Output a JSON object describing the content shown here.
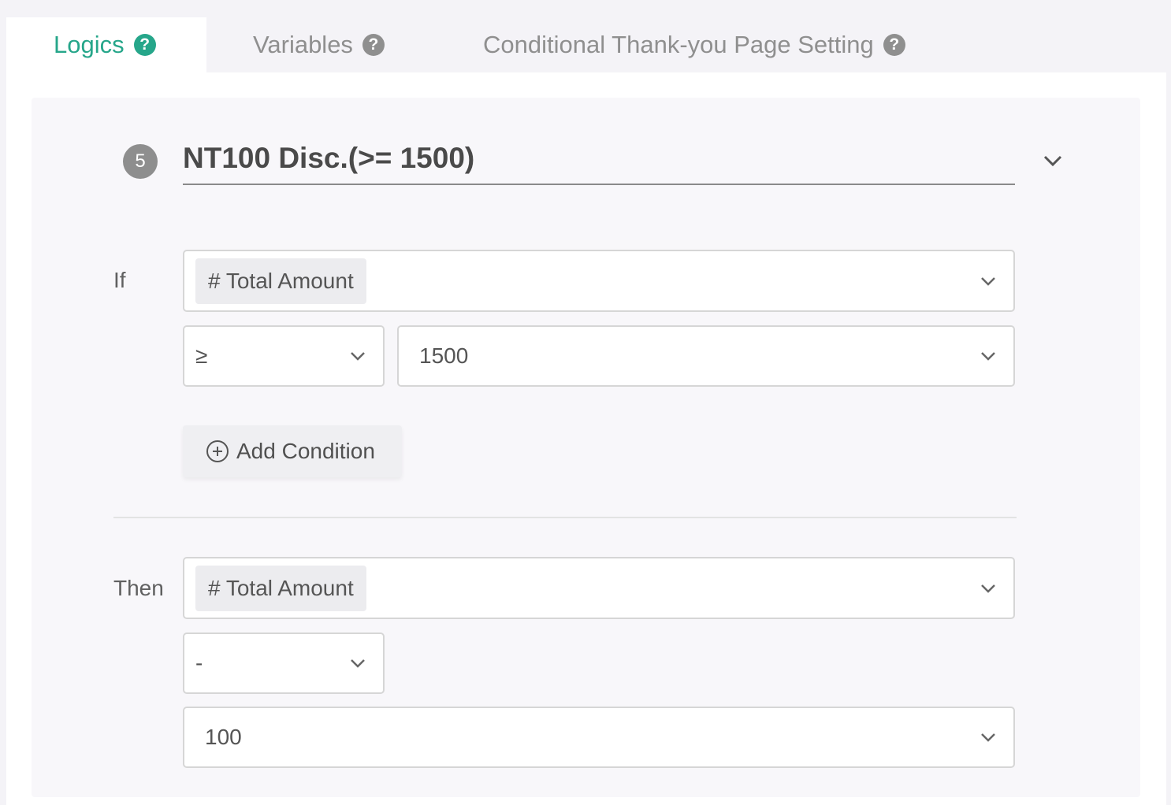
{
  "tabs": [
    {
      "label": "Logics",
      "icon": "question-circle-icon",
      "active": true
    },
    {
      "label": "Variables",
      "icon": "question-circle-icon",
      "active": false
    },
    {
      "label": "Conditional Thank-you Page Setting",
      "icon": "question-circle-icon",
      "active": false
    }
  ],
  "rule": {
    "number": "5",
    "title": "NT100 Disc.(>= 1500)"
  },
  "if": {
    "label": "If",
    "field": "# Total Amount",
    "operator": "≥",
    "value": "1500",
    "add_condition_label": "Add Condition"
  },
  "then": {
    "label": "Then",
    "field": "# Total Amount",
    "operator": "-",
    "value": "100"
  },
  "colors": {
    "accent": "#26a68a",
    "inactive_tab": "#8f8f8f",
    "badge": "#8e8e8e"
  }
}
